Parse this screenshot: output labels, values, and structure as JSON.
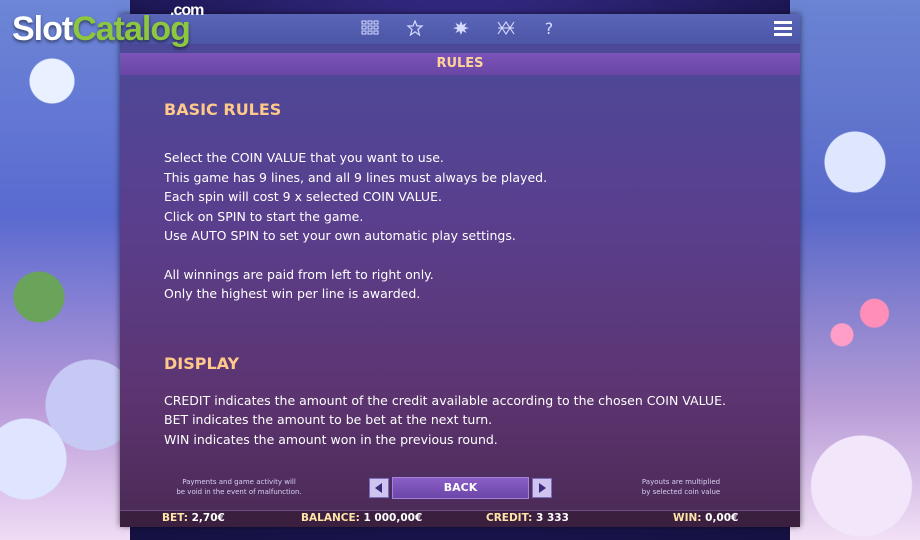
{
  "watermark": {
    "slot": "Slot",
    "catalog": "Catalog",
    "com": ".com"
  },
  "nav": {
    "icons": [
      "paytable-grid-icon",
      "star-icon",
      "splash-icon",
      "lines-icon",
      "question-icon"
    ],
    "help_glyph": "?"
  },
  "title": "RULES",
  "basic_rules": {
    "heading": "BASIC RULES",
    "lines": [
      "Select the COIN VALUE that you want to use.",
      "This game has 9 lines, and all 9 lines must always be played.",
      "Each spin will cost 9 x selected COIN VALUE.",
      "Click on SPIN to start the game.",
      "Use AUTO SPIN to set your own automatic play settings.",
      "All winnings are paid from left to right only.",
      "Only the highest win per line is awarded."
    ]
  },
  "display": {
    "heading": "DISPLAY",
    "lines": [
      "CREDIT indicates the amount of the credit available according to the chosen COIN VALUE.",
      "BET indicates the amount to be bet at the next turn.",
      "WIN indicates the amount won in the previous round."
    ]
  },
  "footer": {
    "left_note_1": "Payments and game activity will",
    "left_note_2": "be void in the event of malfunction.",
    "right_note_1": "Payouts are multiplied",
    "right_note_2": "by selected coin value",
    "back_label": "BACK"
  },
  "status": {
    "bet_label": "BET:",
    "bet_value": "2,70€",
    "balance_label": "BALANCE:",
    "balance_value": "1 000,00€",
    "credit_label": "CREDIT:",
    "credit_value": "3 333",
    "win_label": "WIN:",
    "win_value": "0,00€"
  },
  "colors": {
    "accent": "#ffc98a",
    "panel": "#5a3f8e",
    "statusbar": "#3b1f3f"
  }
}
